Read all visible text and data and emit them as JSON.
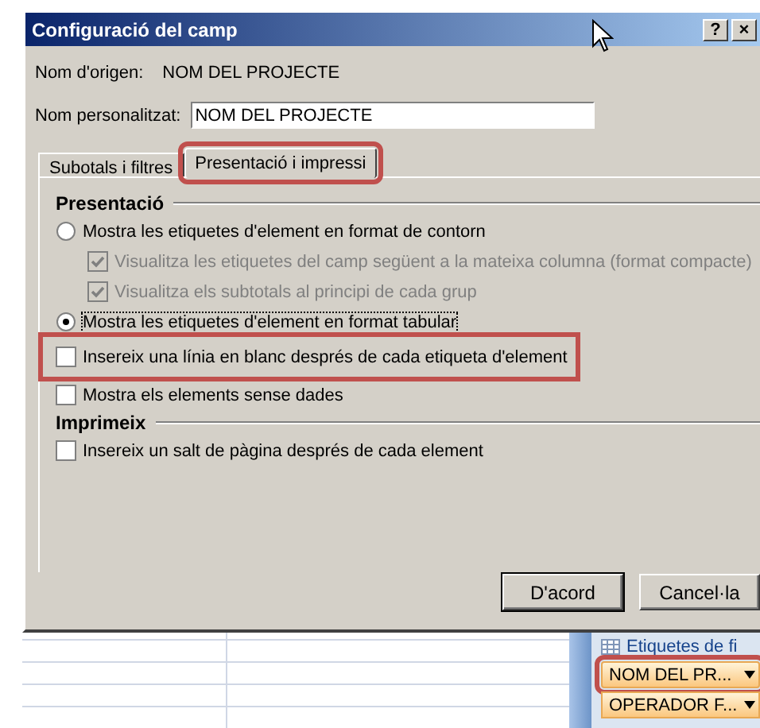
{
  "window": {
    "title": "Configuració del camp",
    "title_buttons": [
      "?",
      "×"
    ]
  },
  "source_name": {
    "label": "Nom d'origen:",
    "value": "NOM DEL PROJECTE"
  },
  "custom_name": {
    "label": "Nom personalitzat:",
    "value": "NOM DEL PROJECTE"
  },
  "tabs": [
    {
      "label": "Subotals i filtres",
      "selected": false,
      "highlighted": false
    },
    {
      "label": "Presentació i impressi",
      "selected": true,
      "highlighted": true
    }
  ],
  "sections": [
    {
      "heading": "Presentació",
      "options": [
        {
          "kind": "radio",
          "label": "Mostra les etiquetes d'element en format de contorn",
          "checked": false,
          "disabled": false,
          "focused": false,
          "highlighted": false,
          "children": [
            {
              "kind": "checkbox",
              "label": "Visualitza les etiquetes del camp següent a la mateixa columna (format compacte)",
              "checked": true,
              "disabled": true,
              "focused": false,
              "highlighted": false
            },
            {
              "kind": "checkbox",
              "label": "Visualitza els subtotals al principi de cada grup",
              "checked": true,
              "disabled": true,
              "focused": false,
              "highlighted": false
            }
          ]
        },
        {
          "kind": "radio",
          "label": "Mostra les etiquetes d'element en format tabular",
          "checked": true,
          "disabled": false,
          "focused": true,
          "highlighted": false
        },
        {
          "kind": "checkbox",
          "label": "Insereix una línia en blanc després de cada etiqueta d'element",
          "checked": false,
          "disabled": false,
          "focused": false,
          "highlighted": true
        },
        {
          "kind": "checkbox",
          "label": "Mostra els elements sense dades",
          "checked": false,
          "disabled": false,
          "focused": false,
          "highlighted": false
        }
      ]
    },
    {
      "heading": "Imprimeix",
      "options": [
        {
          "kind": "checkbox",
          "label": "Insereix un salt de pàgina després de cada element",
          "checked": false,
          "disabled": false,
          "focused": false,
          "highlighted": false
        }
      ]
    }
  ],
  "buttons": [
    {
      "label": "D'acord"
    },
    {
      "label": "Cancel·la"
    }
  ],
  "pivot_panel": {
    "heading": "Etiquetes de fi",
    "fields": [
      {
        "label": "NOM DEL PR...",
        "highlighted": true
      },
      {
        "label": "OPERADOR F...",
        "highlighted": false
      }
    ]
  }
}
